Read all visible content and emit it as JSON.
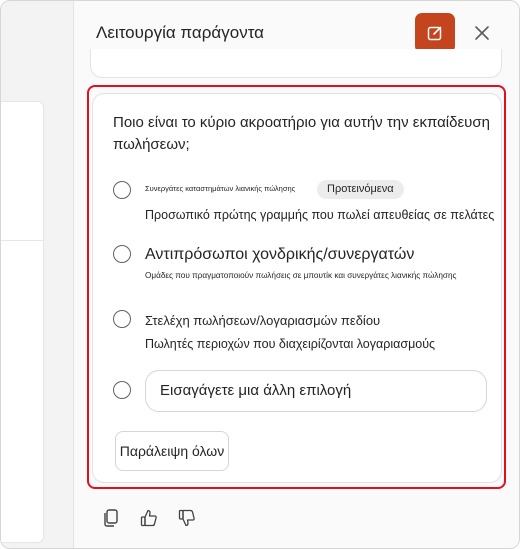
{
  "panel": {
    "title": "Λειτουργία παράγοντα"
  },
  "question": {
    "text": "Ποιο είναι το κύριο ακροατήριο για αυτήν την εκπαίδευση πωλήσεων;",
    "options": [
      {
        "label": "Συνεργάτες καταστημάτων λιανικής πώλησης",
        "badge": "Προτεινόμενα",
        "description": "Προσωπικό πρώτης γραμμής που πωλεί απευθείας σε πελάτες"
      },
      {
        "label": "Αντιπρόσωποι χονδρικής/συνεργατών",
        "description": "Ομάδες που πραγματοποιούν πωλήσεις σε μπουτίκ και συνεργάτες λιανικής πώλησης"
      },
      {
        "label": "Στελέχη πωλήσεων/λογαριασμών πεδίου",
        "description": "Πωλητές περιοχών που διαχειρίζονται λογαριασμούς"
      }
    ],
    "other_placeholder": "Εισαγάγετε μια άλλη επιλογή",
    "skip_label": "Παράλειψη όλων"
  },
  "colors": {
    "accent": "#c4441d",
    "highlight": "#e0101e"
  },
  "icons": {
    "edit": "compose-icon",
    "close": "close-icon",
    "copy": "copy-icon",
    "like": "thumbs-up-icon",
    "dislike": "thumbs-down-icon"
  }
}
